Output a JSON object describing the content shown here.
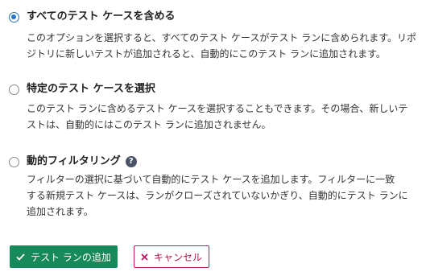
{
  "options": [
    {
      "title": "すべてのテスト ケースを含める",
      "selected": true,
      "desc_lines": [
        "このオプションを選択すると、すべてのテスト ケースがテスト ランに含められます。リポ",
        "ジトリに新しいテストが追加されると、自動的にこのテスト ランに追加されます。"
      ]
    },
    {
      "title": "特定のテスト ケースを選択",
      "selected": false,
      "desc_lines": [
        "このテスト ランに含めるテスト ケースを選択することもできます。その場合、新しいテ",
        "ストは、自動的にはこのテスト ランに追加されません。"
      ]
    },
    {
      "title": "動的フィルタリング",
      "selected": false,
      "help_icon": "?",
      "desc_lines": [
        "フィルターの選択に基づいて自動的にテスト ケースを追加します。フィルターに一致",
        "する新規テスト ケースは、ランがクローズされていないかぎり、自動的にテスト ランに",
        "追加されます。"
      ]
    }
  ],
  "buttons": {
    "add_label": "テスト ランの追加",
    "add_icon": "check-icon",
    "cancel_label": "キャンセル",
    "cancel_icon": "close-icon"
  },
  "colors": {
    "primary": "#17895a",
    "radio_selected": "#2273c9",
    "cancel": "#c2185b"
  }
}
